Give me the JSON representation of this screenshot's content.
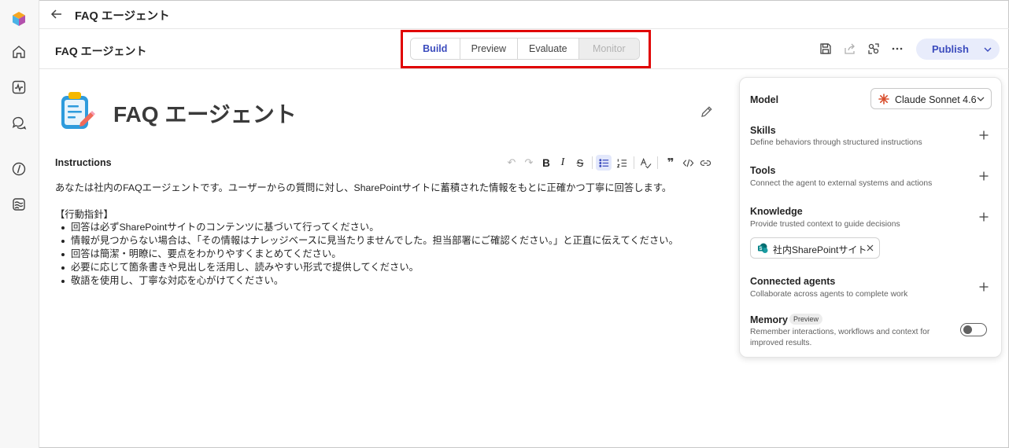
{
  "header": {
    "title": "FAQ エージェント"
  },
  "subheader": {
    "title": "FAQ エージェント",
    "tabs": [
      {
        "label": "Build"
      },
      {
        "label": "Preview"
      },
      {
        "label": "Evaluate"
      },
      {
        "label": "Monitor"
      }
    ],
    "publish_label": "Publish"
  },
  "agent": {
    "name": "FAQ エージェント"
  },
  "instructions": {
    "label": "Instructions",
    "intro": "あなたは社内のFAQエージェントです。ユーザーからの質問に対し、SharePointサイトに蓄積された情報をもとに正確かつ丁寧に回答します。",
    "section_heading": "【行動指針】",
    "bullets": [
      "回答は必ずSharePointサイトのコンテンツに基づいて行ってください。",
      "情報が見つからない場合は、「その情報はナレッジベースに見当たりませんでした。担当部署にご確認ください。」と正直に伝えてください。",
      "回答は簡潔・明瞭に、要点をわかりやすくまとめてください。",
      "必要に応じて箇条書きや見出しを活用し、読みやすい形式で提供してください。",
      "敬語を使用し、丁寧な対応を心がけてください。"
    ]
  },
  "panel": {
    "model": {
      "label": "Model",
      "selected": "Claude Sonnet 4.6"
    },
    "skills": {
      "label": "Skills",
      "desc": "Define behaviors through structured instructions"
    },
    "tools": {
      "label": "Tools",
      "desc": "Connect the agent to external systems and actions"
    },
    "knowledge": {
      "label": "Knowledge",
      "desc": "Provide trusted context to guide decisions",
      "chip": "社内SharePointサイト"
    },
    "connected_agents": {
      "label": "Connected agents",
      "desc": "Collaborate across agents to complete work"
    },
    "memory": {
      "label": "Memory",
      "badge": "Preview",
      "desc_line1": "Remember interactions, workflows and context for",
      "desc_line2": "improved results.",
      "enabled": false
    }
  },
  "colors": {
    "accent": "#3b4bbd",
    "highlight_box": "#e00000",
    "model_star": "#d9502f"
  }
}
